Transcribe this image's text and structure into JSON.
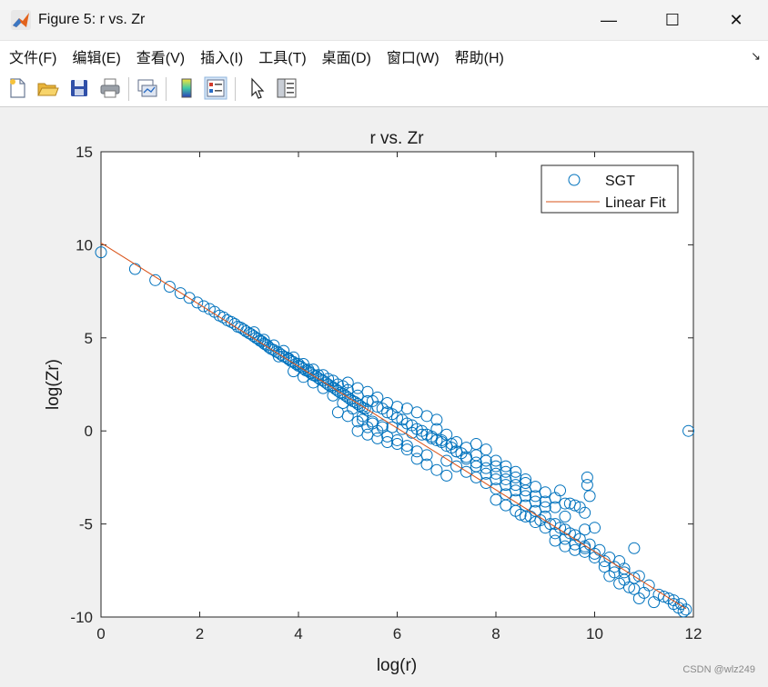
{
  "window": {
    "title": "Figure 5: r vs. Zr",
    "minimize_glyph": "—",
    "maximize_glyph": "☐",
    "close_glyph": "✕"
  },
  "menu": {
    "items": [
      "文件(F)",
      "编辑(E)",
      "查看(V)",
      "插入(I)",
      "工具(T)",
      "桌面(D)",
      "窗口(W)",
      "帮助(H)"
    ],
    "overflow_glyph": "↘"
  },
  "toolbar": {
    "icons": [
      "new-figure-icon",
      "open-file-icon",
      "save-icon",
      "print-icon",
      "link-plot-icon",
      "colorbar-icon",
      "legend-icon",
      "pointer-icon",
      "property-inspector-icon"
    ]
  },
  "colors": {
    "marker": "#0072bd",
    "fit_line": "#d95319",
    "axes_bg": "#ffffff",
    "figure_bg": "#f0f0f0"
  },
  "watermark": "CSDN @wlz249",
  "chart_data": {
    "type": "scatter",
    "title": "r vs. Zr",
    "xlabel": "log(r)",
    "ylabel": "log(Zr)",
    "xlim": [
      0,
      12
    ],
    "ylim": [
      -10,
      15
    ],
    "xticks": [
      0,
      2,
      4,
      6,
      8,
      10,
      12
    ],
    "yticks": [
      -10,
      -5,
      0,
      5,
      10,
      15
    ],
    "grid": false,
    "legend_position": "top-right",
    "series": [
      {
        "name": "SGT",
        "kind": "scatter",
        "marker": "circle"
      },
      {
        "name": "Linear Fit",
        "kind": "line"
      }
    ],
    "fit_line": {
      "x": [
        0,
        11.85
      ],
      "y": [
        10.1,
        -9.55
      ]
    },
    "points": [
      [
        0.0,
        9.6
      ],
      [
        0.69,
        8.7
      ],
      [
        1.1,
        8.1
      ],
      [
        1.39,
        7.75
      ],
      [
        1.61,
        7.4
      ],
      [
        1.79,
        7.15
      ],
      [
        1.95,
        6.9
      ],
      [
        2.08,
        6.7
      ],
      [
        2.2,
        6.55
      ],
      [
        2.3,
        6.4
      ],
      [
        2.4,
        6.2
      ],
      [
        2.48,
        6.1
      ],
      [
        2.56,
        5.95
      ],
      [
        2.64,
        5.85
      ],
      [
        2.71,
        5.75
      ],
      [
        2.77,
        5.6
      ],
      [
        2.83,
        5.55
      ],
      [
        2.89,
        5.45
      ],
      [
        2.94,
        5.35
      ],
      [
        3.0,
        5.25
      ],
      [
        3.04,
        5.2
      ],
      [
        3.09,
        5.1
      ],
      [
        3.14,
        5.0
      ],
      [
        3.18,
        4.95
      ],
      [
        3.22,
        4.85
      ],
      [
        3.26,
        4.8
      ],
      [
        3.3,
        4.7
      ],
      [
        3.33,
        4.65
      ],
      [
        3.37,
        4.6
      ],
      [
        3.4,
        4.5
      ],
      [
        3.45,
        4.4
      ],
      [
        3.5,
        4.35
      ],
      [
        3.55,
        4.25
      ],
      [
        3.6,
        4.2
      ],
      [
        3.65,
        4.1
      ],
      [
        3.7,
        4.0
      ],
      [
        3.75,
        3.95
      ],
      [
        3.8,
        3.85
      ],
      [
        3.85,
        3.75
      ],
      [
        3.9,
        3.7
      ],
      [
        3.95,
        3.6
      ],
      [
        4.0,
        3.5
      ],
      [
        4.05,
        3.45
      ],
      [
        4.1,
        3.35
      ],
      [
        4.15,
        3.25
      ],
      [
        4.2,
        3.2
      ],
      [
        4.25,
        3.1
      ],
      [
        4.3,
        3.0
      ],
      [
        4.35,
        2.95
      ],
      [
        4.4,
        2.85
      ],
      [
        4.45,
        2.75
      ],
      [
        4.5,
        2.7
      ],
      [
        4.55,
        2.6
      ],
      [
        4.6,
        2.5
      ],
      [
        4.65,
        2.4
      ],
      [
        4.7,
        2.35
      ],
      [
        4.75,
        2.25
      ],
      [
        4.8,
        2.15
      ],
      [
        4.85,
        2.05
      ],
      [
        4.9,
        2.0
      ],
      [
        4.95,
        1.9
      ],
      [
        5.0,
        1.8
      ],
      [
        5.05,
        1.7
      ],
      [
        5.1,
        1.6
      ],
      [
        5.15,
        1.55
      ],
      [
        5.2,
        1.45
      ],
      [
        5.25,
        1.35
      ],
      [
        5.3,
        1.25
      ],
      [
        5.35,
        1.2
      ],
      [
        5.4,
        1.1
      ],
      [
        3.1,
        5.3
      ],
      [
        3.3,
        4.9
      ],
      [
        3.5,
        4.6
      ],
      [
        3.7,
        4.3
      ],
      [
        3.9,
        3.95
      ],
      [
        4.1,
        3.6
      ],
      [
        4.3,
        3.3
      ],
      [
        4.5,
        3.0
      ],
      [
        4.7,
        2.7
      ],
      [
        4.9,
        2.4
      ],
      [
        3.9,
        3.2
      ],
      [
        4.1,
        2.9
      ],
      [
        4.3,
        2.6
      ],
      [
        4.5,
        2.3
      ],
      [
        4.7,
        1.9
      ],
      [
        4.9,
        1.5
      ],
      [
        5.1,
        1.2
      ],
      [
        5.3,
        0.8
      ],
      [
        5.5,
        0.5
      ],
      [
        5.7,
        0.2
      ],
      [
        4.8,
        1.0
      ],
      [
        5.0,
        0.8
      ],
      [
        5.2,
        0.5
      ],
      [
        5.4,
        0.2
      ],
      [
        5.6,
        0.0
      ],
      [
        5.8,
        -0.3
      ],
      [
        6.0,
        -0.5
      ],
      [
        6.2,
        -0.8
      ],
      [
        6.4,
        -1.1
      ],
      [
        6.6,
        -1.3
      ],
      [
        5.0,
        2.6
      ],
      [
        5.2,
        2.3
      ],
      [
        5.4,
        2.1
      ],
      [
        5.6,
        1.8
      ],
      [
        5.8,
        1.5
      ],
      [
        6.0,
        1.3
      ],
      [
        6.2,
        1.2
      ],
      [
        6.4,
        1.0
      ],
      [
        6.6,
        0.8
      ],
      [
        6.8,
        0.6
      ],
      [
        5.2,
        0.0
      ],
      [
        5.4,
        -0.2
      ],
      [
        5.6,
        -0.4
      ],
      [
        5.8,
        -0.6
      ],
      [
        6.0,
        -0.7
      ],
      [
        6.2,
        -1.0
      ],
      [
        6.4,
        -1.5
      ],
      [
        6.6,
        -1.8
      ],
      [
        6.8,
        -2.1
      ],
      [
        7.0,
        -2.4
      ],
      [
        5.5,
        1.6
      ],
      [
        5.7,
        1.2
      ],
      [
        5.9,
        0.9
      ],
      [
        6.1,
        0.6
      ],
      [
        6.3,
        0.3
      ],
      [
        6.5,
        0.0
      ],
      [
        6.7,
        -0.3
      ],
      [
        6.9,
        -0.6
      ],
      [
        7.1,
        -0.9
      ],
      [
        7.3,
        -1.2
      ],
      [
        5.3,
        0.6
      ],
      [
        5.5,
        0.4
      ],
      [
        5.7,
        0.3
      ],
      [
        5.9,
        0.2
      ],
      [
        6.1,
        0.1
      ],
      [
        6.3,
        -0.1
      ],
      [
        6.5,
        -0.2
      ],
      [
        6.7,
        -0.4
      ],
      [
        6.9,
        -0.5
      ],
      [
        7.1,
        -0.7
      ],
      [
        6.8,
        0.1
      ],
      [
        7.0,
        -0.2
      ],
      [
        7.2,
        -0.6
      ],
      [
        7.4,
        -0.9
      ],
      [
        7.6,
        -1.3
      ],
      [
        7.8,
        -1.6
      ],
      [
        8.0,
        -1.9
      ],
      [
        8.2,
        -2.2
      ],
      [
        8.4,
        -2.5
      ],
      [
        8.6,
        -2.8
      ],
      [
        7.0,
        -1.6
      ],
      [
        7.2,
        -1.9
      ],
      [
        7.4,
        -2.2
      ],
      [
        7.6,
        -2.5
      ],
      [
        7.8,
        -2.8
      ],
      [
        8.0,
        -3.1
      ],
      [
        8.2,
        -3.4
      ],
      [
        8.4,
        -3.7
      ],
      [
        8.6,
        -4.0
      ],
      [
        8.8,
        -4.3
      ],
      [
        7.2,
        -1.1
      ],
      [
        7.4,
        -1.4
      ],
      [
        7.6,
        -1.9
      ],
      [
        7.8,
        -2.3
      ],
      [
        8.0,
        -2.6
      ],
      [
        8.2,
        -2.9
      ],
      [
        8.4,
        -3.2
      ],
      [
        8.6,
        -3.5
      ],
      [
        8.8,
        -3.8
      ],
      [
        9.0,
        -4.1
      ],
      [
        7.6,
        -0.7
      ],
      [
        7.8,
        -1.0
      ],
      [
        8.0,
        -1.6
      ],
      [
        8.2,
        -1.9
      ],
      [
        8.4,
        -2.2
      ],
      [
        8.6,
        -2.6
      ],
      [
        8.8,
        -3.0
      ],
      [
        9.0,
        -3.3
      ],
      [
        9.2,
        -3.6
      ],
      [
        9.4,
        -3.9
      ],
      [
        8.0,
        -3.7
      ],
      [
        8.2,
        -4.0
      ],
      [
        8.4,
        -4.3
      ],
      [
        8.6,
        -4.6
      ],
      [
        8.8,
        -4.9
      ],
      [
        9.0,
        -5.2
      ],
      [
        9.2,
        -5.5
      ],
      [
        9.4,
        -5.8
      ],
      [
        9.6,
        -6.1
      ],
      [
        9.8,
        -6.3
      ],
      [
        8.5,
        -4.5
      ],
      [
        8.7,
        -4.6
      ],
      [
        8.9,
        -4.8
      ],
      [
        9.1,
        -5.0
      ],
      [
        9.3,
        -5.2
      ],
      [
        9.5,
        -5.5
      ],
      [
        9.7,
        -5.8
      ],
      [
        9.9,
        -6.1
      ],
      [
        10.1,
        -6.4
      ],
      [
        10.3,
        -6.8
      ],
      [
        9.0,
        -4.6
      ],
      [
        9.2,
        -5.0
      ],
      [
        9.4,
        -5.3
      ],
      [
        9.6,
        -5.6
      ],
      [
        9.8,
        -6.2
      ],
      [
        10.0,
        -6.6
      ],
      [
        10.2,
        -7.0
      ],
      [
        10.4,
        -7.3
      ],
      [
        10.6,
        -7.6
      ],
      [
        10.8,
        -7.9
      ],
      [
        9.3,
        -3.2
      ],
      [
        9.5,
        -3.9
      ],
      [
        9.6,
        -4.0
      ],
      [
        9.7,
        -4.1
      ],
      [
        9.8,
        -4.4
      ],
      [
        9.8,
        -5.3
      ],
      [
        9.85,
        -2.5
      ],
      [
        9.85,
        -2.9
      ],
      [
        9.9,
        -3.5
      ],
      [
        10.0,
        -5.2
      ],
      [
        9.2,
        -5.9
      ],
      [
        9.4,
        -6.2
      ],
      [
        9.6,
        -6.4
      ],
      [
        9.8,
        -6.5
      ],
      [
        10.0,
        -6.8
      ],
      [
        10.2,
        -7.3
      ],
      [
        10.4,
        -7.6
      ],
      [
        10.6,
        -8.0
      ],
      [
        10.8,
        -8.5
      ],
      [
        11.0,
        -8.7
      ],
      [
        10.5,
        -7.0
      ],
      [
        10.6,
        -7.4
      ],
      [
        10.8,
        -6.3
      ],
      [
        10.9,
        -7.8
      ],
      [
        11.1,
        -8.3
      ],
      [
        11.3,
        -8.8
      ],
      [
        11.5,
        -9.0
      ],
      [
        11.6,
        -9.3
      ],
      [
        11.7,
        -9.5
      ],
      [
        11.8,
        -9.7
      ],
      [
        10.3,
        -7.8
      ],
      [
        10.5,
        -8.2
      ],
      [
        10.7,
        -8.4
      ],
      [
        10.9,
        -9.0
      ],
      [
        11.2,
        -9.2
      ],
      [
        11.4,
        -8.9
      ],
      [
        11.6,
        -9.1
      ],
      [
        11.75,
        -9.3
      ],
      [
        11.85,
        -9.6
      ],
      [
        11.9,
        0.0
      ],
      [
        3.6,
        4.0
      ],
      [
        3.8,
        3.9
      ],
      [
        4.0,
        3.6
      ],
      [
        4.2,
        3.3
      ],
      [
        4.4,
        3.0
      ],
      [
        4.6,
        2.8
      ],
      [
        4.8,
        2.5
      ],
      [
        5.0,
        2.2
      ],
      [
        5.2,
        1.9
      ],
      [
        5.4,
        1.6
      ],
      [
        5.6,
        1.3
      ],
      [
        5.8,
        1.0
      ],
      [
        6.0,
        0.7
      ],
      [
        6.2,
        0.4
      ],
      [
        6.4,
        0.1
      ],
      [
        6.6,
        -0.2
      ],
      [
        6.8,
        -0.5
      ],
      [
        7.0,
        -0.8
      ],
      [
        7.2,
        -1.1
      ],
      [
        7.4,
        -1.5
      ],
      [
        7.6,
        -1.7
      ],
      [
        7.8,
        -2.0
      ],
      [
        8.0,
        -2.3
      ],
      [
        8.2,
        -2.6
      ],
      [
        8.4,
        -2.9
      ],
      [
        8.6,
        -3.2
      ],
      [
        8.8,
        -3.5
      ],
      [
        9.0,
        -3.8
      ],
      [
        9.2,
        -4.1
      ],
      [
        9.4,
        -4.6
      ]
    ]
  }
}
